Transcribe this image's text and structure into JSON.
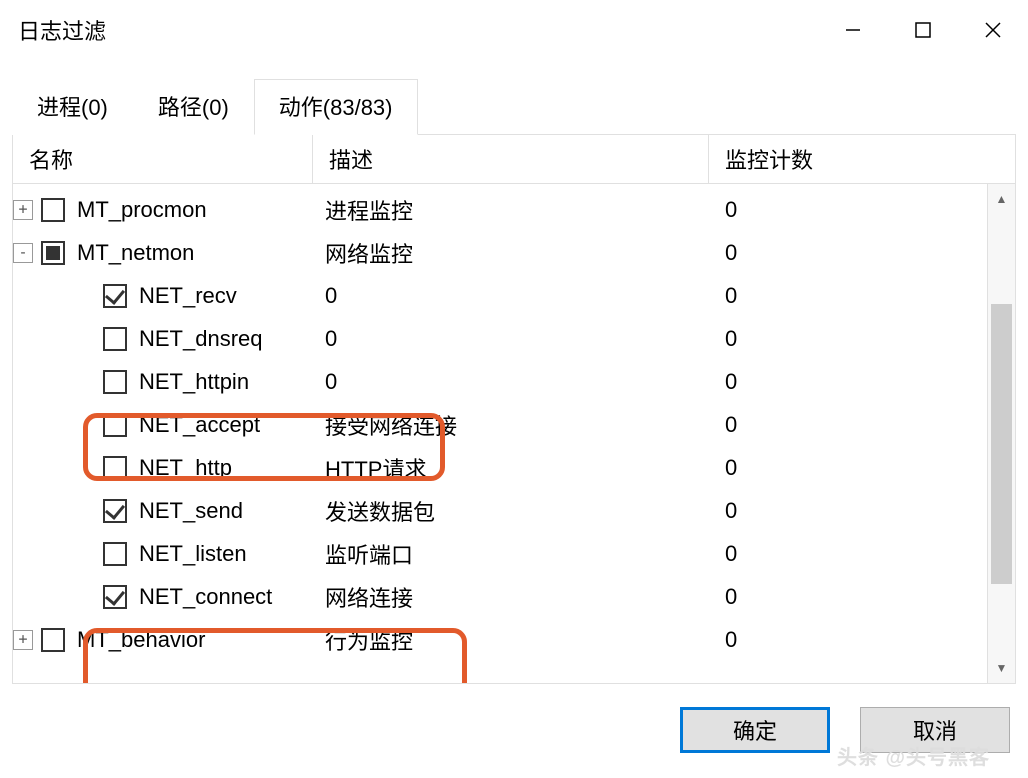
{
  "window": {
    "title": "日志过滤"
  },
  "tabs": [
    {
      "label": "进程(0)",
      "active": false
    },
    {
      "label": "路径(0)",
      "active": false
    },
    {
      "label": "动作(83/83)",
      "active": true
    }
  ],
  "columns": {
    "name": "名称",
    "desc": "描述",
    "count": "监控计数"
  },
  "tree": [
    {
      "indent": 0,
      "expander": "+",
      "check": "unchecked",
      "name": "MT_procmon",
      "desc": "进程监控",
      "count": "0",
      "highlight": false
    },
    {
      "indent": 0,
      "expander": "-",
      "check": "mixed",
      "name": "MT_netmon",
      "desc": "网络监控",
      "count": "0",
      "highlight": false
    },
    {
      "indent": 1,
      "expander": "",
      "check": "checked",
      "name": "NET_recv",
      "desc": "0",
      "count": "0",
      "highlight": true
    },
    {
      "indent": 1,
      "expander": "",
      "check": "unchecked",
      "name": "NET_dnsreq",
      "desc": "0",
      "count": "0",
      "highlight": false
    },
    {
      "indent": 1,
      "expander": "",
      "check": "unchecked",
      "name": "NET_httpin",
      "desc": "0",
      "count": "0",
      "highlight": false
    },
    {
      "indent": 1,
      "expander": "",
      "check": "unchecked",
      "name": "NET_accept",
      "desc": "接受网络连接",
      "count": "0",
      "highlight": false
    },
    {
      "indent": 1,
      "expander": "",
      "check": "unchecked",
      "name": "NET_http",
      "desc": "HTTP请求",
      "count": "0",
      "highlight": false
    },
    {
      "indent": 1,
      "expander": "",
      "check": "checked",
      "name": "NET_send",
      "desc": "发送数据包",
      "count": "0",
      "highlight": true
    },
    {
      "indent": 1,
      "expander": "",
      "check": "unchecked",
      "name": "NET_listen",
      "desc": "监听端口",
      "count": "0",
      "highlight": false
    },
    {
      "indent": 1,
      "expander": "",
      "check": "checked",
      "name": "NET_connect",
      "desc": "网络连接",
      "count": "0",
      "highlight": true
    },
    {
      "indent": 0,
      "expander": "+",
      "check": "unchecked",
      "name": "MT_behavior",
      "desc": "行为监控",
      "count": "0",
      "highlight": false
    }
  ],
  "buttons": {
    "ok": "确定",
    "cancel": "取消"
  },
  "watermark": "头条 @头号黑客"
}
